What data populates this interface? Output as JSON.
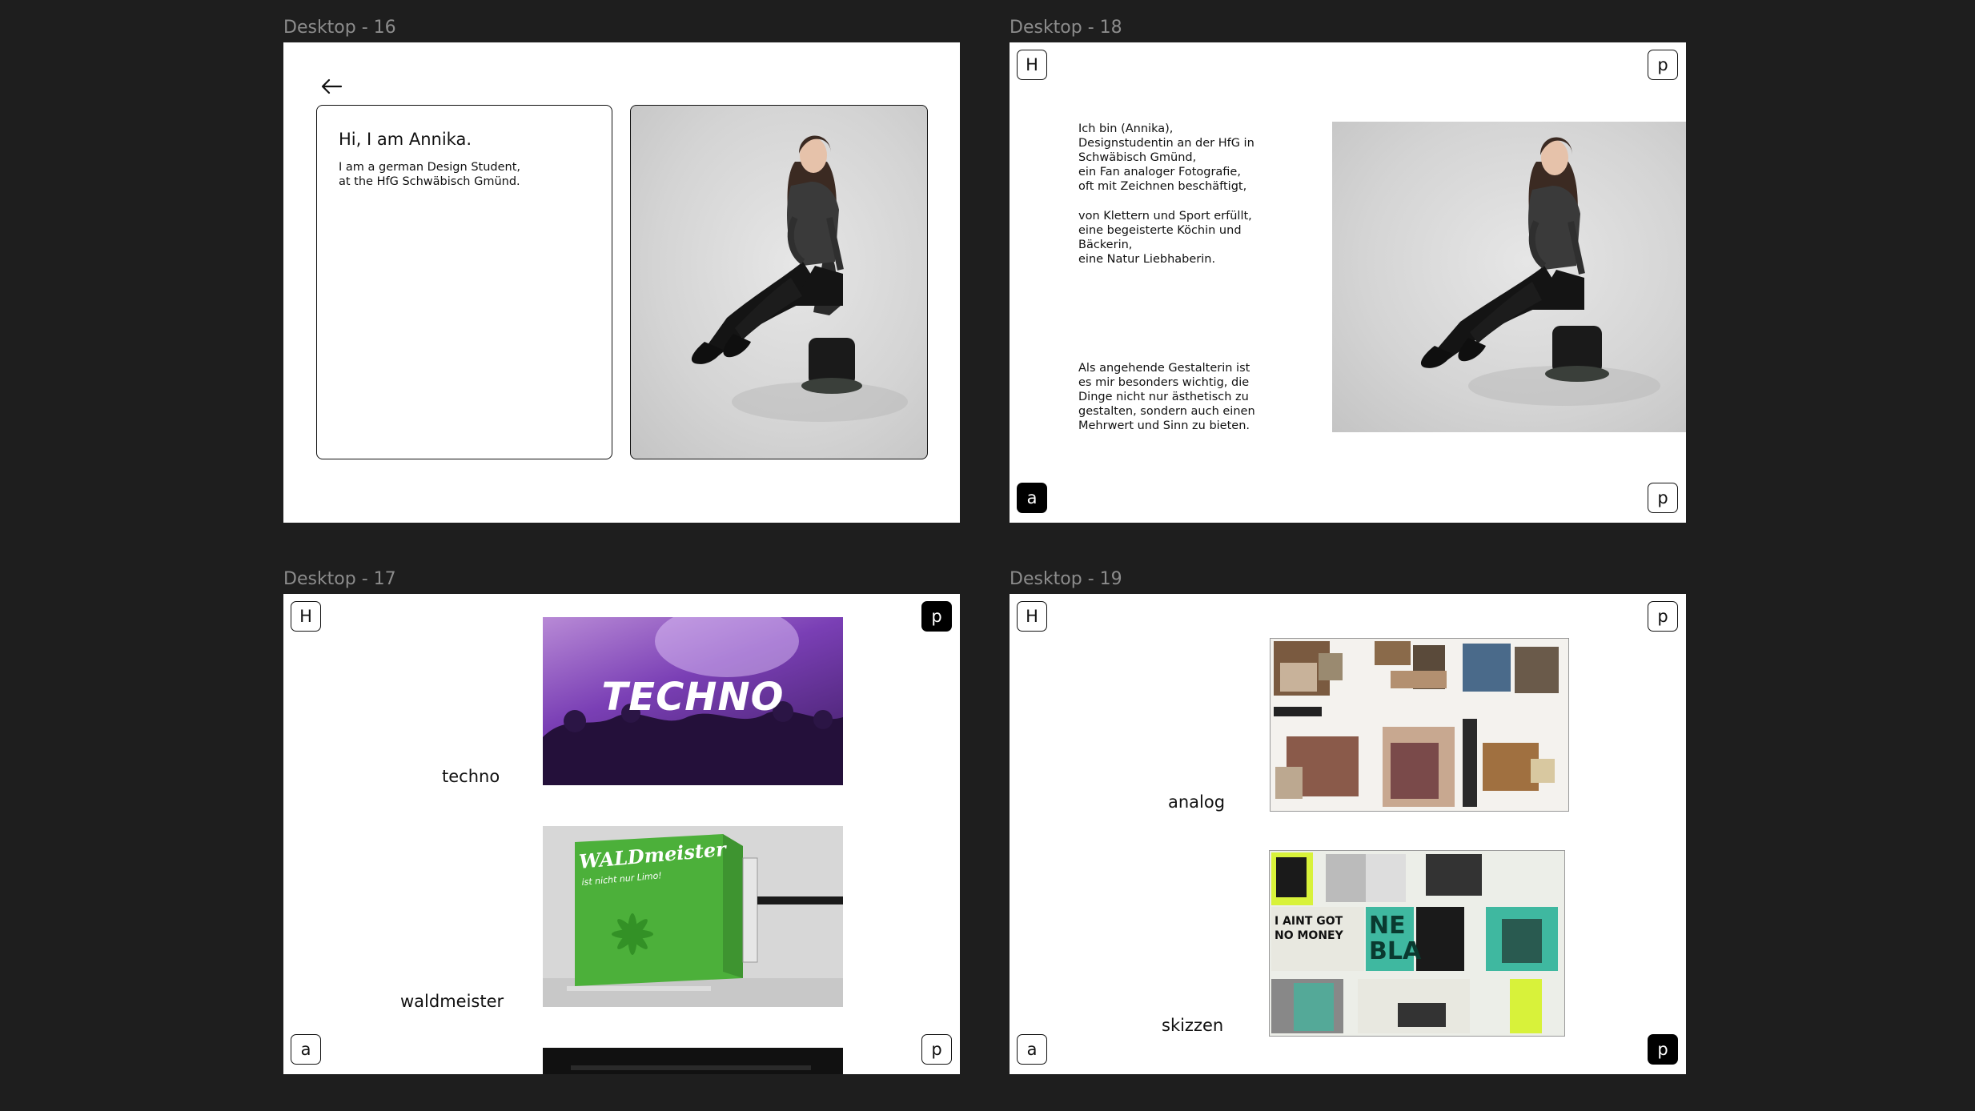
{
  "frames": {
    "d16": {
      "label": "Desktop - 16",
      "greeting": "Hi, I am Annika.",
      "intro_line1": "I am a german Design Student,",
      "intro_line2": "at the HfG Schwäbisch Gmünd."
    },
    "d18": {
      "label": "Desktop - 18",
      "btn_top_left": "H",
      "btn_top_right": "p",
      "btn_bottom_left": "a",
      "btn_bottom_right": "p",
      "para1": [
        "Ich bin (Annika),",
        "Designstudentin an der HfG in",
        "Schwäbisch Gmünd,",
        "ein Fan analoger Fotografie,",
        "oft mit Zeichnen beschäftigt,"
      ],
      "para2": [
        "von Klettern und Sport erfüllt,",
        "eine begeisterte Köchin und",
        "Bäckerin,",
        "eine Natur Liebhaberin."
      ],
      "para3": [
        "Als angehende Gestalterin ist",
        "es mir besonders wichtig, die",
        "Dinge nicht nur ästhetisch zu",
        "gestalten, sondern auch einen",
        "Mehrwert und Sinn zu bieten."
      ]
    },
    "d17": {
      "label": "Desktop - 17",
      "btn_top_left": "H",
      "btn_top_right": "p",
      "btn_bottom_left": "a",
      "btn_bottom_right": "p",
      "caption1": "techno",
      "caption2": "waldmeister",
      "techno_text": "TECHNO",
      "wald_text_1": "WALDmeister",
      "wald_text_2": "ist nicht nur Limo!"
    },
    "d19": {
      "label": "Desktop - 19",
      "btn_top_left": "H",
      "btn_top_right": "p",
      "btn_bottom_left": "a",
      "btn_bottom_right": "p",
      "caption1": "analog",
      "caption2": "skizzen",
      "zine_text_1": "I AINT GOT",
      "zine_text_2": "NO MONEY",
      "zine_text_3": "NE",
      "zine_text_4": "BLA"
    }
  },
  "icons": {
    "back": "arrow-left-icon"
  },
  "colors": {
    "canvas": "#1e1e1e",
    "frame": "#ffffff",
    "label": "#8c8c8c",
    "accent_purple": "#7a3fb5",
    "accent_green": "#4cb03a",
    "accent_lime": "#d8f23a",
    "accent_teal": "#3fb8a0"
  }
}
